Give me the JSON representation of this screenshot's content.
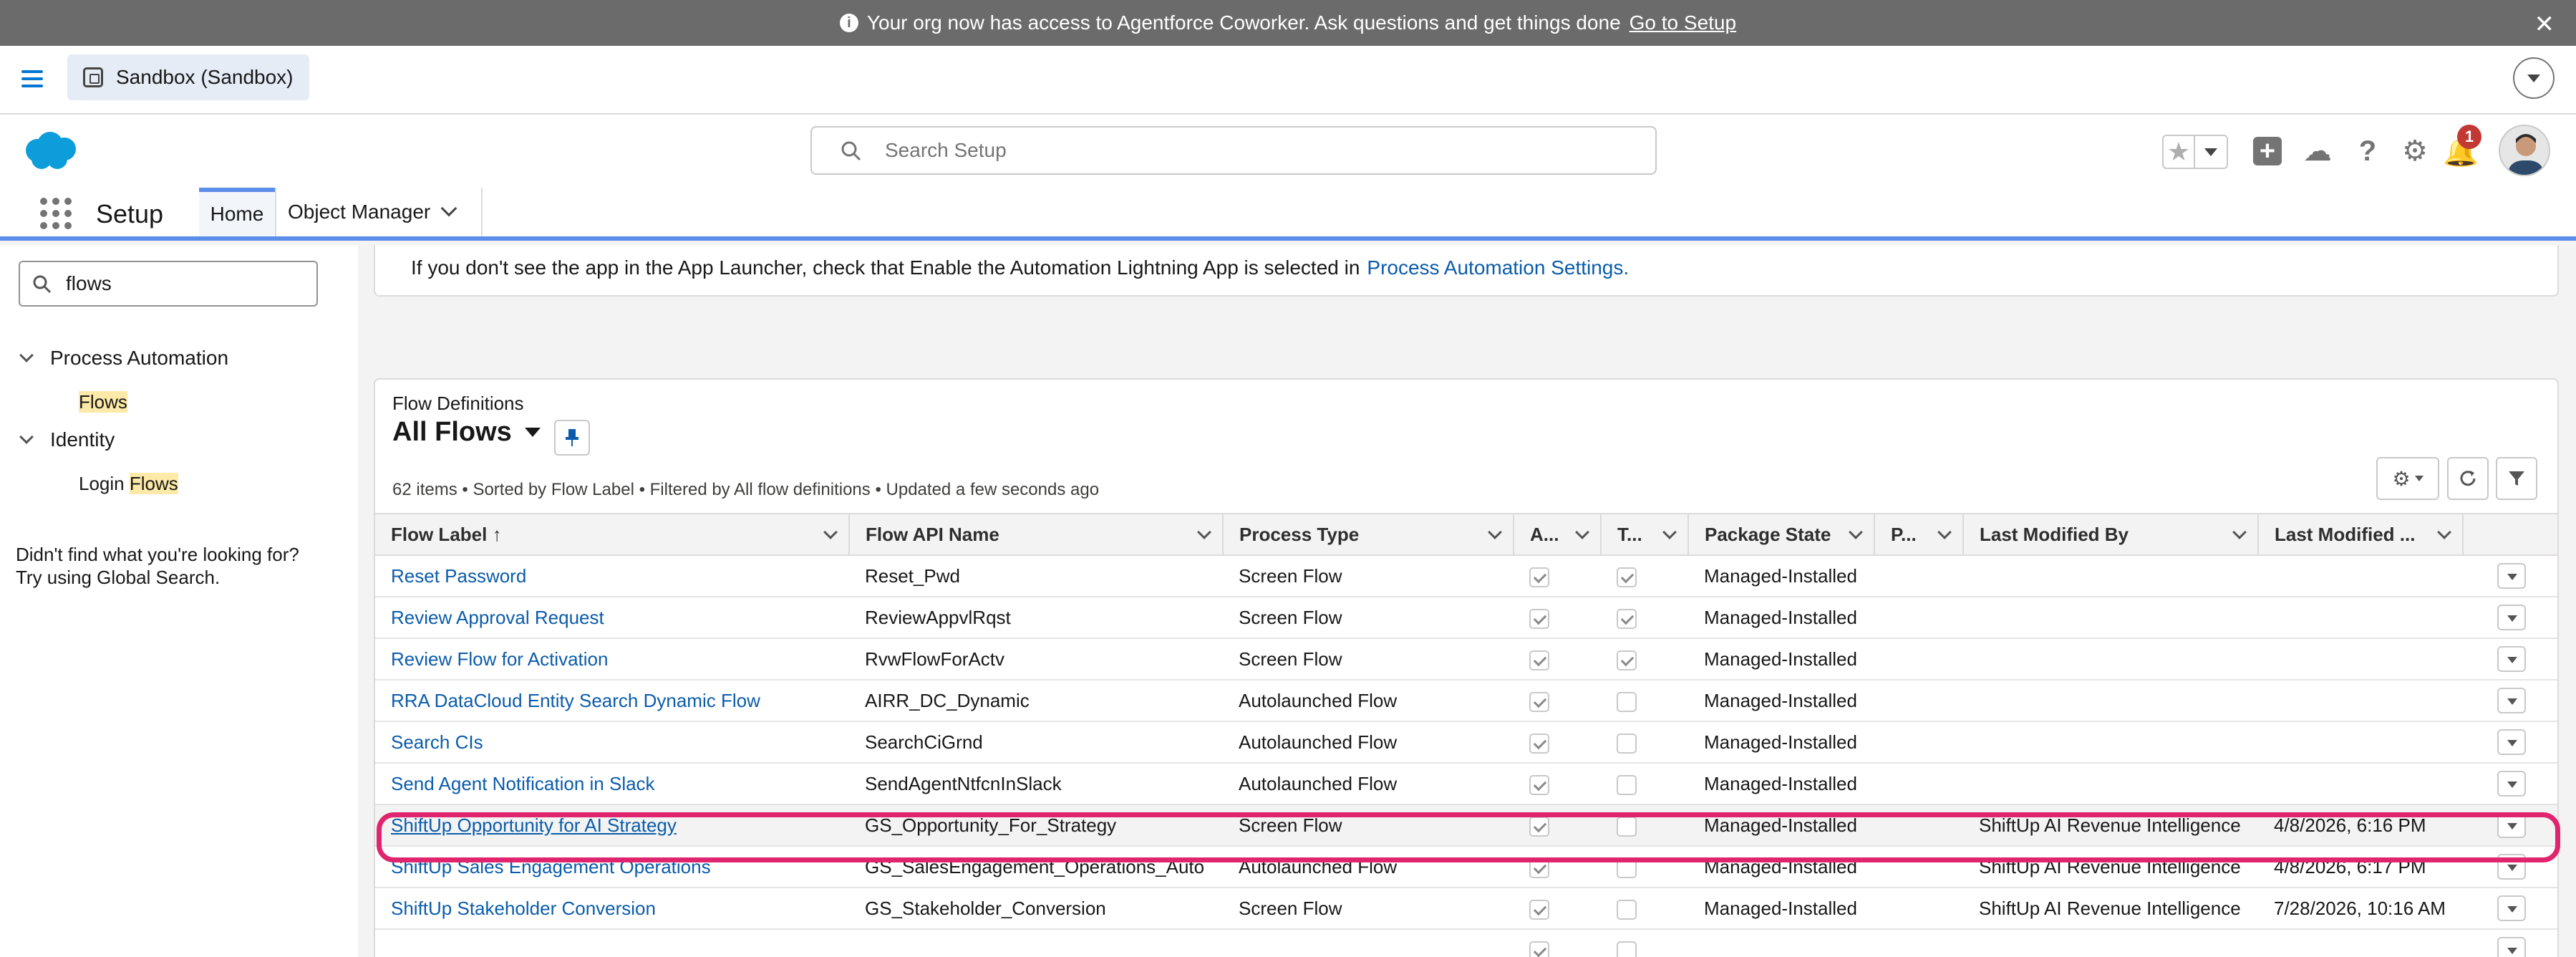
{
  "banner": {
    "message": "Your org now has access to Agentforce Coworker. Ask questions and get things done",
    "link_text": "Go to Setup",
    "info_glyph": "i",
    "close_glyph": "✕"
  },
  "topbar": {
    "org_name": "Sandbox (Sandbox)"
  },
  "header": {
    "search_placeholder": "Search Setup",
    "notification_count": "1",
    "star_glyph": "★",
    "plus_glyph": "+",
    "help_glyph": "?",
    "gear_glyph": "⚙",
    "bell_glyph": "🔔",
    "trailhead_glyph": "☁"
  },
  "nav": {
    "app_name": "Setup",
    "tabs": [
      {
        "label": "Home"
      },
      {
        "label": "Object Manager"
      }
    ]
  },
  "sidebar": {
    "quick_find_value": "flows",
    "tree": [
      {
        "label": "Process Automation",
        "children": [
          {
            "label": "Flows",
            "highlight": "Flows"
          }
        ]
      },
      {
        "label": "Identity",
        "children": [
          {
            "label_prefix": "Login ",
            "highlight": "Flows"
          }
        ]
      }
    ],
    "not_found_line1": "Didn't find what you're looking for?",
    "not_found_line2": "Try using Global Search."
  },
  "info_card": {
    "text": "If you don't see the app in the App Launcher, check that Enable the Automation Lightning App is selected in",
    "link_text": "Process Automation Settings."
  },
  "list_view": {
    "object_label": "Flow Definitions",
    "view_name": "All Flows",
    "info": "62 items • Sorted by Flow Label • Filtered by All flow definitions • Updated a few seconds ago",
    "columns": [
      {
        "label": "Flow Label ↑"
      },
      {
        "label": "Flow API Name"
      },
      {
        "label": "Process Type"
      },
      {
        "label": "A..."
      },
      {
        "label": "T..."
      },
      {
        "label": "Package State"
      },
      {
        "label": "P..."
      },
      {
        "label": "Last Modified By"
      },
      {
        "label": "Last Modified ..."
      }
    ],
    "rows": [
      {
        "label": "Reset Password",
        "api": "Reset_Pwd",
        "type": "Screen Flow",
        "active": true,
        "template": true,
        "package_state": "Managed-Installed",
        "p": "",
        "modified_by": "",
        "modified": ""
      },
      {
        "label": "Review Approval Request",
        "api": "ReviewAppvlRqst",
        "type": "Screen Flow",
        "active": true,
        "template": true,
        "package_state": "Managed-Installed",
        "p": "",
        "modified_by": "",
        "modified": ""
      },
      {
        "label": "Review Flow for Activation",
        "api": "RvwFlowForActv",
        "type": "Screen Flow",
        "active": true,
        "template": true,
        "package_state": "Managed-Installed",
        "p": "",
        "modified_by": "",
        "modified": ""
      },
      {
        "label": "RRA DataCloud Entity Search Dynamic Flow",
        "api": "AIRR_DC_Dynamic",
        "type": "Autolaunched Flow",
        "active": true,
        "template": false,
        "package_state": "Managed-Installed",
        "p": "",
        "modified_by": "",
        "modified": ""
      },
      {
        "label": "Search CIs",
        "api": "SearchCiGrnd",
        "type": "Autolaunched Flow",
        "active": true,
        "template": false,
        "package_state": "Managed-Installed",
        "p": "",
        "modified_by": "",
        "modified": ""
      },
      {
        "label": "Send Agent Notification in Slack",
        "api": "SendAgentNtfcnInSlack",
        "type": "Autolaunched Flow",
        "active": true,
        "template": false,
        "package_state": "Managed-Installed",
        "p": "",
        "modified_by": "",
        "modified": ""
      },
      {
        "label": "ShiftUp Opportunity for AI Strategy",
        "api": "GS_Opportunity_For_Strategy",
        "type": "Screen Flow",
        "active": true,
        "template": false,
        "package_state": "Managed-Installed",
        "p": "",
        "modified_by": "ShiftUp AI Revenue Intelligence",
        "modified": "4/8/2026, 6:16 PM",
        "highlight": true
      },
      {
        "label": "ShiftUp Sales Engagement Operations",
        "api": "GS_SalesEngagement_Operations_Auto",
        "type": "Autolaunched Flow",
        "active": true,
        "template": false,
        "package_state": "Managed-Installed",
        "p": "",
        "modified_by": "ShiftUp AI Revenue Intelligence",
        "modified": "4/8/2026, 6:17 PM"
      },
      {
        "label": "ShiftUp Stakeholder Conversion",
        "api": "GS_Stakeholder_Conversion",
        "type": "Screen Flow",
        "active": true,
        "template": false,
        "package_state": "Managed-Installed",
        "p": "",
        "modified_by": "ShiftUp AI Revenue Intelligence",
        "modified": "7/28/2026, 10:16 AM"
      },
      {
        "label": "",
        "api": "",
        "type": "",
        "active": true,
        "template": false,
        "package_state": "",
        "p": "",
        "modified_by": "",
        "modified": ""
      }
    ]
  },
  "colors": {
    "brand_blue": "#0176d3",
    "link_blue": "#0b5cab",
    "highlight_ring": "#e0246e",
    "badge_red": "#c23934"
  }
}
